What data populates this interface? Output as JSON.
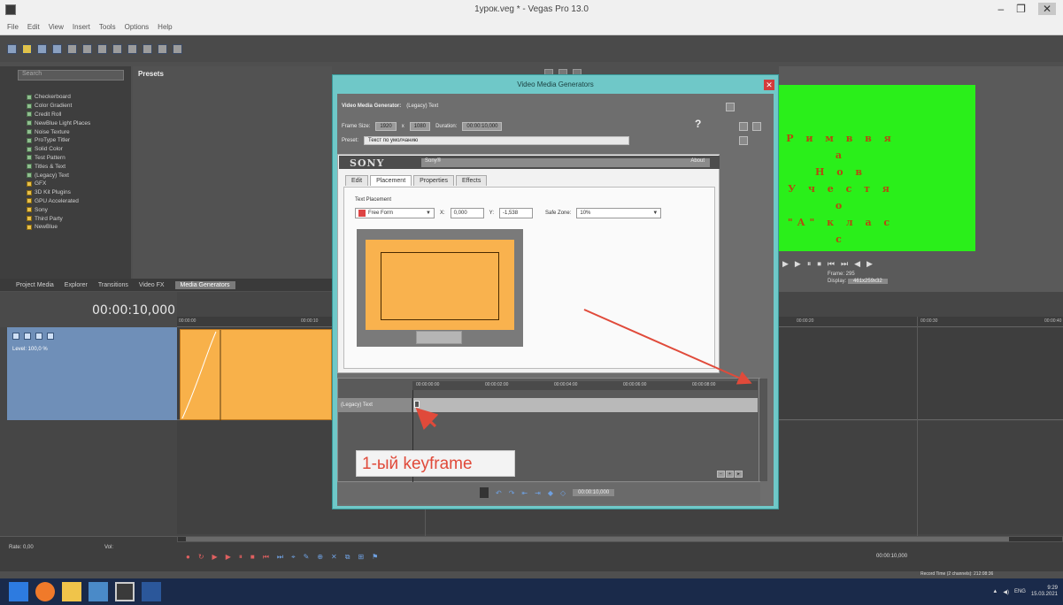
{
  "window": {
    "title": "1урок.veg * - Vegas Pro 13.0",
    "controls": [
      "–",
      "❐",
      "✕"
    ]
  },
  "menu": [
    "File",
    "Edit",
    "View",
    "Insert",
    "Tools",
    "Options",
    "Help"
  ],
  "explorer": {
    "search_placeholder": "Search",
    "presets_label": "Presets",
    "tree": [
      {
        "label": "Checkerboard",
        "type": "item"
      },
      {
        "label": "Color Gradient",
        "type": "item"
      },
      {
        "label": "Credit Roll",
        "type": "item"
      },
      {
        "label": "NewBlue Light Places",
        "type": "item"
      },
      {
        "label": "Noise Texture",
        "type": "item"
      },
      {
        "label": "ProType Titler",
        "type": "item"
      },
      {
        "label": "Solid Color",
        "type": "item"
      },
      {
        "label": "Test Pattern",
        "type": "item"
      },
      {
        "label": "Titles & Text",
        "type": "item"
      },
      {
        "label": "(Legacy) Text",
        "type": "item"
      },
      {
        "label": "GFX",
        "type": "folder"
      },
      {
        "label": "3D Kit Plugins",
        "type": "folder"
      },
      {
        "label": "GPU Accelerated",
        "type": "folder"
      },
      {
        "label": "Sony",
        "type": "folder"
      },
      {
        "label": "Third Party",
        "type": "folder"
      },
      {
        "label": "NewBlue",
        "type": "folder"
      }
    ]
  },
  "window_tabs": [
    "Project Media",
    "Explorer",
    "Transitions",
    "Video FX",
    "Media Generators"
  ],
  "preview": {
    "text_lines": [
      "Р и м в в я а",
      "Н о в",
      "У ч е с т я о",
      "\"А\" к л а с с"
    ],
    "controls": [
      "▶",
      "▶",
      "⏸",
      "⏹",
      "⏮",
      "⏭",
      "◀",
      "▶"
    ],
    "frame_label": "Frame: 295",
    "display_label": "Display:",
    "display_value": "461x259x32"
  },
  "timeline": {
    "timecode": "00:00:10,000",
    "ruler_marks": [
      "00:00:00",
      "00:00:10",
      "00:00:20",
      "00:00:30",
      "00:00:40"
    ],
    "track_level": "Level: 100,0 %",
    "rate_label": "Rate: 0,00",
    "vol_label": "Vol:",
    "right_timecode": "00:00:10,000",
    "record_time": "Record Time (2 channels): 212:08:36"
  },
  "dialog": {
    "title": "Video Media Generators",
    "close": "✕",
    "generator_label": "Video Media Generator:",
    "generator_value": "(Legacy) Text",
    "frame_size_label": "Frame Size:",
    "frame_w": "1920",
    "frame_x": "x",
    "frame_h": "1080",
    "duration_label": "Duration:",
    "duration_value": "00:00:10,000",
    "preset_label": "Preset:",
    "preset_value": "Текст по умолчанию",
    "help_mark": "?",
    "sony_logo": "SONY",
    "sony_field": "Sony®",
    "sony_about": "About",
    "tabs": [
      "Edit",
      "Placement",
      "Properties",
      "Effects"
    ],
    "active_tab": "Placement",
    "placement_label": "Text Placement",
    "free_form": "Free Form",
    "x_label": "X:",
    "x_value": "0,000",
    "y_label": "Y:",
    "y_value": "-1,538",
    "safe_zone_label": "Safe Zone:",
    "safe_zone_value": "10%"
  },
  "keyframes": {
    "ruler_marks": [
      "00:00:00:00",
      "00:00:02:00",
      "00:00:04:00",
      "00:00:06:00",
      "00:00:08:00"
    ],
    "track_name": "(Legacy) Text",
    "annotation": "1-ый keyframe",
    "bottom_timecode": "00:00:10,000",
    "bottom_btns": [
      "↶",
      "↷",
      "⇤",
      "⇥",
      "◆",
      "◇"
    ]
  },
  "taskbar": {
    "clock_time": "9:29",
    "clock_date": "15.03.2021",
    "lang": "ENG"
  },
  "colors": {
    "dialog_border": "#6fc8c8",
    "preview_green": "#2aef1a",
    "clip_orange": "#f9b24e",
    "annotation_red": "#e04a3a"
  }
}
